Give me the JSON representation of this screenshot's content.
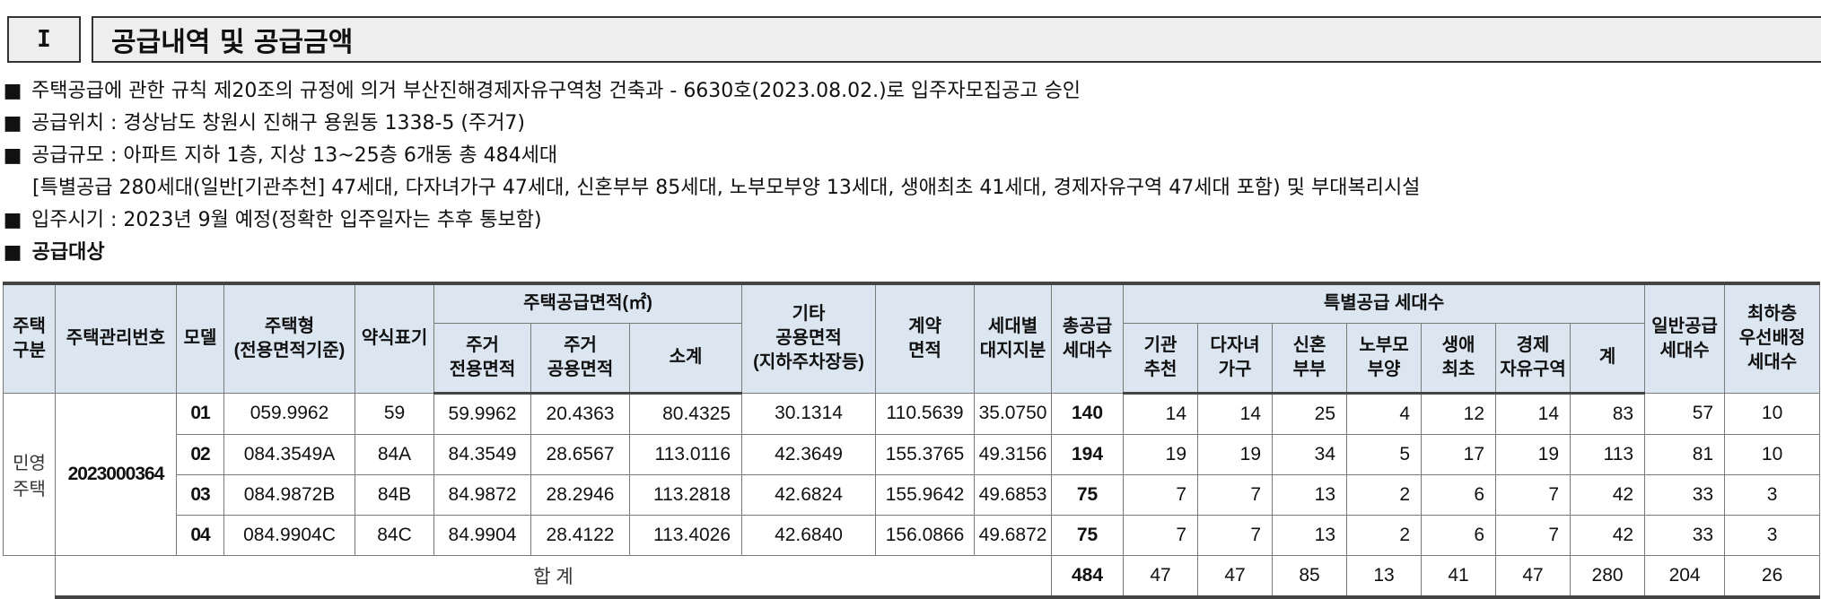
{
  "section": {
    "number": "I",
    "title": "공급내역 및 공급금액"
  },
  "notes": [
    "주택공급에 관한 규칙 제20조의 규정에 의거 부산진해경제자유구역청 건축과 - 6630호(2023.08.02.)로 입주자모집공고 승인",
    "공급위치 : 경상남도 창원시 진해구 용원동 1338-5 (주거7)",
    "공급규모 : 아파트 지하 1층, 지상 13~25층 6개동 총 484세대"
  ],
  "note_cont": "[특별공급 280세대(일반[기관추천] 47세대, 다자녀가구 47세대, 신혼부부 85세대, 노부모부양 13세대, 생애최초 41세대, 경제자유구역 47세대 포함) 및 부대복리시설",
  "note_last": "입주시기 : 2023년 9월 예정(정확한 입주일자는 추후 통보함)",
  "bullet": "■",
  "target_title": "공급대상",
  "table": {
    "headers": {
      "house_type_1": "주택",
      "house_type_2": "구분",
      "mgmt_no": "주택관리번호",
      "model": "모델",
      "type_1": "주택형",
      "type_2": "(전용면적기준)",
      "abbr": "약식표기",
      "area_group": "주택공급면적(㎡)",
      "excl_1": "주거",
      "excl_2": "전용면적",
      "comm_1": "주거",
      "comm_2": "공용면적",
      "subtotal": "소계",
      "other_1": "기타",
      "other_2": "공용면적",
      "other_3": "(지하주차장등)",
      "contract_1": "계약",
      "contract_2": "면적",
      "land_1": "세대별",
      "land_2": "대지지분",
      "total_1": "총공급",
      "total_2": "세대수",
      "special_group": "특별공급 세대수",
      "inst_1": "기관",
      "inst_2": "추천",
      "multi_1": "다자녀",
      "multi_2": "가구",
      "newly_1": "신혼",
      "newly_2": "부부",
      "elder_1": "노부모",
      "elder_2": "부양",
      "first_1": "생애",
      "first_2": "최초",
      "econ_1": "경제",
      "econ_2": "자유구역",
      "sum": "계",
      "general_1": "일반공급",
      "general_2": "세대수",
      "lowest_1": "최하층",
      "lowest_2": "우선배정",
      "lowest_3": "세대수"
    },
    "category_1": "민영",
    "category_2": "주택",
    "mgmt_no": "2023000364",
    "rows": [
      {
        "model": "01",
        "type": "059.9962",
        "abbr": "59",
        "excl": "59.9962",
        "comm": "20.4363",
        "subtotal": "80.4325",
        "other": "30.1314",
        "contract": "110.5639",
        "land": "35.0750",
        "total": "140",
        "inst": "14",
        "multi": "14",
        "newly": "25",
        "elder": "4",
        "first": "12",
        "econ": "14",
        "sum": "83",
        "general": "57",
        "lowest": "10"
      },
      {
        "model": "02",
        "type": "084.3549A",
        "abbr": "84A",
        "excl": "84.3549",
        "comm": "28.6567",
        "subtotal": "113.0116",
        "other": "42.3649",
        "contract": "155.3765",
        "land": "49.3156",
        "total": "194",
        "inst": "19",
        "multi": "19",
        "newly": "34",
        "elder": "5",
        "first": "17",
        "econ": "19",
        "sum": "113",
        "general": "81",
        "lowest": "10"
      },
      {
        "model": "03",
        "type": "084.9872B",
        "abbr": "84B",
        "excl": "84.9872",
        "comm": "28.2946",
        "subtotal": "113.2818",
        "other": "42.6824",
        "contract": "155.9642",
        "land": "49.6853",
        "total": "75",
        "inst": "7",
        "multi": "7",
        "newly": "13",
        "elder": "2",
        "first": "6",
        "econ": "7",
        "sum": "42",
        "general": "33",
        "lowest": "3"
      },
      {
        "model": "04",
        "type": "084.9904C",
        "abbr": "84C",
        "excl": "84.9904",
        "comm": "28.4122",
        "subtotal": "113.4026",
        "other": "42.6840",
        "contract": "156.0866",
        "land": "49.6872",
        "total": "75",
        "inst": "7",
        "multi": "7",
        "newly": "13",
        "elder": "2",
        "first": "6",
        "econ": "7",
        "sum": "42",
        "general": "33",
        "lowest": "3"
      }
    ],
    "totals": {
      "label": "합 계",
      "total": "484",
      "inst": "47",
      "multi": "47",
      "newly": "85",
      "elder": "13",
      "first": "41",
      "econ": "47",
      "sum": "280",
      "general": "204",
      "lowest": "26"
    }
  }
}
